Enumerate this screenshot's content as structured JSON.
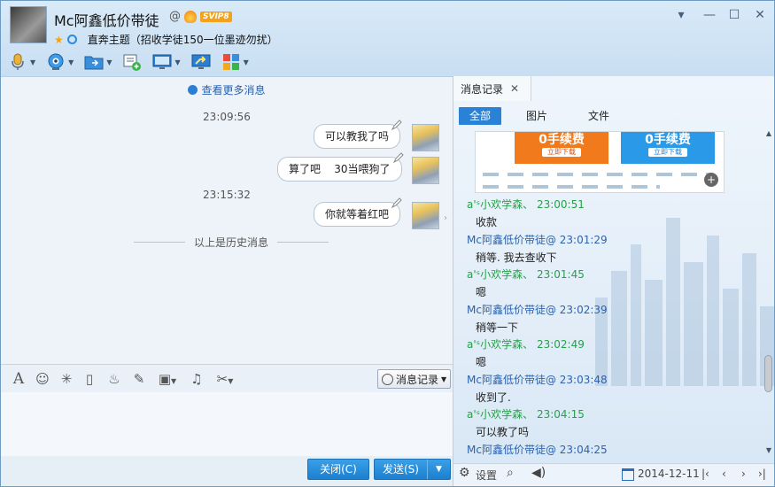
{
  "contact": {
    "name": "Mc阿鑫低价带徒",
    "badge": "SVIP8",
    "signature": "直奔主题（招收学徒150一位墨迹勿扰）"
  },
  "colors": {
    "accent": "#2a82d6",
    "green_name": "#27a04a",
    "blue_name": "#2a63b0"
  },
  "chat": {
    "more_link": "查看更多消息",
    "history_divider": "以上是历史消息",
    "messages": [
      {
        "time": "23:09:56"
      },
      {
        "text": "可以教我了吗"
      },
      {
        "text": "算了吧    30当喂狗了"
      },
      {
        "time": "23:15:32"
      },
      {
        "text": "你就等着红吧"
      }
    ]
  },
  "input_toolbar": {
    "history_button": "消息记录"
  },
  "buttons": {
    "close": "关闭(C)",
    "send": "发送(S)"
  },
  "panel": {
    "tab_title": "消息记录",
    "filters": [
      "全部",
      "图片",
      "文件"
    ],
    "banner": {
      "promo1": "0手续费",
      "promo1_sub": "立即下载",
      "promo2": "0手续费",
      "promo2_sub": "立即下载"
    },
    "records": [
      {
        "name": "a'ˢ小欢学森、",
        "time": "23:00:51",
        "text": "收款",
        "style": "green"
      },
      {
        "name": "Mc阿鑫低价带徒@",
        "time": "23:01:29",
        "text": "稍等. 我去查收下",
        "style": "blue"
      },
      {
        "name": "a'ˢ小欢学森、",
        "time": "23:01:45",
        "text": "嗯",
        "style": "green"
      },
      {
        "name": "Mc阿鑫低价带徒@",
        "time": "23:02:39",
        "text": "稍等一下",
        "style": "blue"
      },
      {
        "name": "a'ˢ小欢学森、",
        "time": "23:02:49",
        "text": "嗯",
        "style": "green"
      },
      {
        "name": "Mc阿鑫低价带徒@",
        "time": "23:03:48",
        "text": "收到了.",
        "style": "blue"
      },
      {
        "name": "a'ˢ小欢学森、",
        "time": "23:04:15",
        "text": "可以教了吗",
        "style": "green"
      },
      {
        "name": "Mc阿鑫低价带徒@",
        "time": "23:04:25",
        "text": "",
        "style": "blue"
      }
    ],
    "footer": {
      "settings": "设置",
      "date": "2014-12-11"
    }
  }
}
